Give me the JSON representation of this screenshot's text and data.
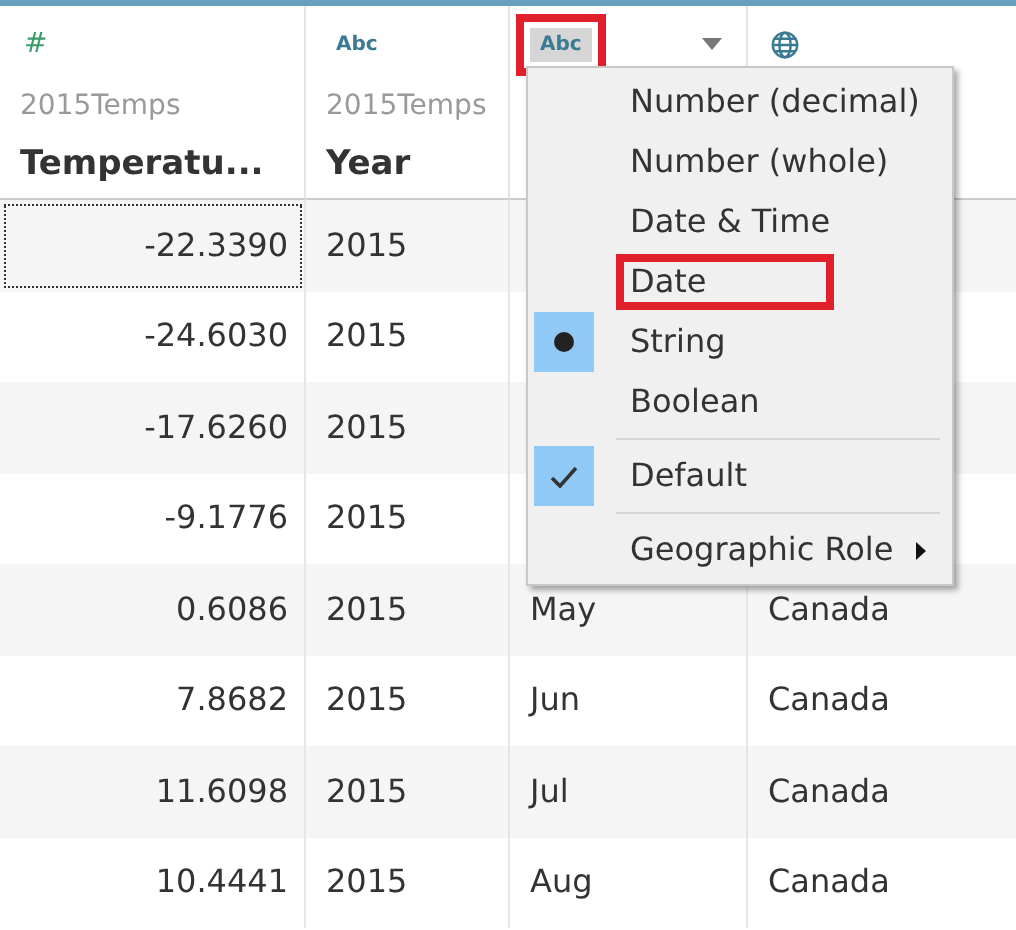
{
  "columns": [
    {
      "kind": "number",
      "type_label": "#",
      "source": "2015Temps",
      "name": "Temperatu...",
      "highlighted": false,
      "menu_open": false
    },
    {
      "kind": "string",
      "type_label": "Abc",
      "source": "2015Temps",
      "name": "Year",
      "highlighted": false,
      "menu_open": false
    },
    {
      "kind": "string",
      "type_label": "Abc",
      "highlighted": true,
      "menu_open": true
    },
    {
      "kind": "geo",
      "highlighted": false,
      "menu_open": false
    }
  ],
  "rows": [
    {
      "cells": [
        "-22.3390",
        "2015"
      ],
      "focused": true
    },
    {
      "cells": [
        "-24.6030",
        "2015"
      ],
      "focused": false
    },
    {
      "cells": [
        "-17.6260",
        "2015"
      ],
      "focused": false
    },
    {
      "cells": [
        "-9.1776",
        "2015"
      ],
      "focused": false
    },
    {
      "cells": [
        "0.6086",
        "2015",
        "May",
        "Canada"
      ],
      "focused": false
    },
    {
      "cells": [
        "7.8682",
        "2015",
        "Jun",
        "Canada"
      ],
      "focused": false
    },
    {
      "cells": [
        "11.6098",
        "2015",
        "Jul",
        "Canada"
      ],
      "focused": false
    },
    {
      "cells": [
        "10.4441",
        "2015",
        "Aug",
        "Canada"
      ],
      "focused": false
    }
  ],
  "type_menu": {
    "items": [
      {
        "kind": "radio",
        "label": "Number (decimal)",
        "selected": false,
        "highlighted": false
      },
      {
        "kind": "radio",
        "label": "Number (whole)",
        "selected": false,
        "highlighted": false
      },
      {
        "kind": "radio",
        "label": "Date & Time",
        "selected": false,
        "highlighted": false
      },
      {
        "kind": "radio",
        "label": "Date",
        "selected": false,
        "highlighted": true
      },
      {
        "kind": "radio",
        "label": "String",
        "selected": true,
        "highlighted": false
      },
      {
        "kind": "radio",
        "label": "Boolean",
        "selected": false,
        "highlighted": false
      },
      {
        "kind": "check",
        "label": "Default",
        "checked": true,
        "separator_before": true
      },
      {
        "kind": "submenu",
        "label": "Geographic Role",
        "separator_before": true
      }
    ]
  }
}
